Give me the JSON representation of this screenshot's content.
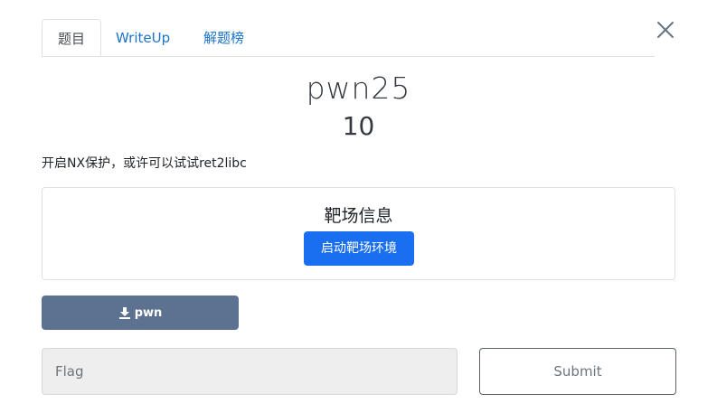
{
  "tabs": [
    {
      "label": "题目",
      "active": true
    },
    {
      "label": "WriteUp",
      "active": false
    },
    {
      "label": "解题榜",
      "active": false
    }
  ],
  "challenge": {
    "name": "pwn25",
    "points": "10",
    "description": "开启NX保护，或许可以试试ret2libc"
  },
  "range_info": {
    "title": "靶场信息",
    "start_button_label": "启动靶场环境"
  },
  "download": {
    "label": "pwn",
    "icon": "download-icon"
  },
  "flag_form": {
    "placeholder": "Flag",
    "value": "",
    "submit_label": "Submit"
  },
  "colors": {
    "link": "#1a73c9",
    "primary": "#1a6ff0",
    "download_bg": "#5c7290",
    "input_bg": "#eeeeee"
  }
}
